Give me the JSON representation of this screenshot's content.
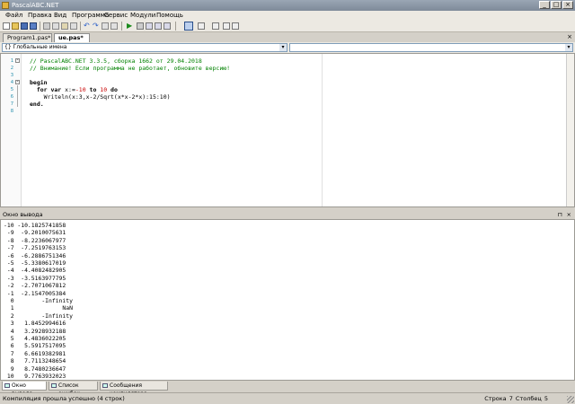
{
  "window": {
    "title": "PascalABC.NET",
    "minimize": "_",
    "maximize": "□",
    "close": "×"
  },
  "menu": [
    "Файл",
    "Правка",
    "Вид",
    "Программа",
    "Сервис",
    "Модули",
    "Помощь"
  ],
  "tabs": [
    {
      "label": "Program1.pas*",
      "active": false
    },
    {
      "label": "ue.pas*",
      "active": true
    }
  ],
  "combos": {
    "left": "{} Глобальные имена",
    "right": ""
  },
  "editor": {
    "line_numbers": [
      "1",
      "2",
      "3",
      "4",
      "5",
      "6",
      "7",
      "8"
    ],
    "lines": [
      {
        "segments": [
          {
            "t": "// PascalABC.NET 3.3.5, сборка 1662 от 29.04.2018",
            "c": "cmt"
          }
        ]
      },
      {
        "segments": [
          {
            "t": "// Внимание! Если программа не работает, обновите версию!",
            "c": "cmt"
          }
        ]
      },
      {
        "segments": [
          {
            "t": "",
            "c": ""
          }
        ]
      },
      {
        "segments": [
          {
            "t": "begin",
            "c": "kw"
          }
        ]
      },
      {
        "segments": [
          {
            "t": "  ",
            "c": ""
          },
          {
            "t": "for var",
            "c": "kw"
          },
          {
            "t": " x:=",
            "c": ""
          },
          {
            "t": "-10",
            "c": "num"
          },
          {
            "t": " to ",
            "c": "kw"
          },
          {
            "t": "10",
            "c": "num"
          },
          {
            "t": " do",
            "c": "kw"
          }
        ]
      },
      {
        "segments": [
          {
            "t": "    Writeln(x:3,x-2/Sqrt(x*x-2*x):15:10)",
            "c": ""
          }
        ]
      },
      {
        "segments": [
          {
            "t": "end.",
            "c": "kw"
          }
        ]
      },
      {
        "segments": [
          {
            "t": "",
            "c": ""
          }
        ]
      }
    ]
  },
  "output_panel": {
    "title": "Окно вывода",
    "pin": "⊓",
    "close": "×",
    "rows": [
      "-10 -10.1825741858",
      " -9  -9.2010075631",
      " -8  -8.2236067977",
      " -7  -7.2519763153",
      " -6  -6.2886751346",
      " -5  -5.3380617019",
      " -4  -4.4082482905",
      " -3  -3.5163977795",
      " -2  -2.7071067812",
      " -1  -2.1547005384",
      "  0        -Infinity",
      "  1              NaN",
      "  2        -Infinity",
      "  3   1.8452994616",
      "  4   3.2928932188",
      "  5   4.4836022205",
      "  6   5.5917517095",
      "  7   6.6619382981",
      "  8   7.7113248654",
      "  9   8.7480236647",
      " 10   9.7763932023"
    ]
  },
  "bottom_tabs": [
    {
      "label": "Окно вывода",
      "active": true
    },
    {
      "label": "Список ошибок",
      "active": false
    },
    {
      "label": "Сообщения компилятора",
      "active": false
    }
  ],
  "status": {
    "message": "Компиляция прошла успешно (4 строк)",
    "position": "Строка 7 Столбец 5"
  },
  "colors": {
    "comment": "#008000",
    "number": "#c80000",
    "line_number": "#2b91af"
  }
}
